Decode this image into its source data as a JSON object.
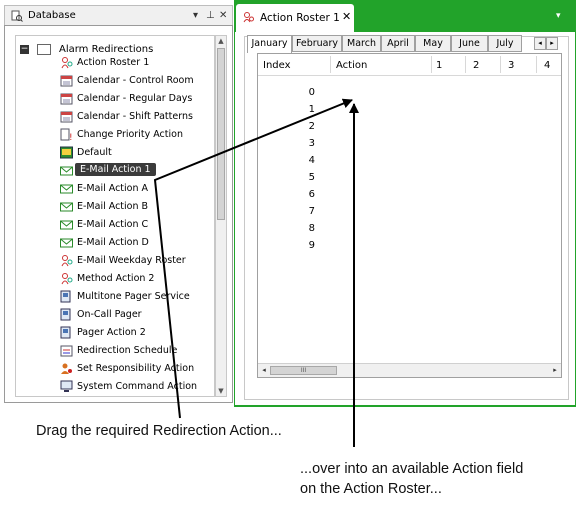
{
  "database_pane": {
    "title": "Database",
    "dropdown_icon": "▾",
    "pin_icon": "⊥",
    "close_icon": "✕",
    "root": {
      "label": "Alarm Redirections",
      "expander": "−"
    },
    "items": [
      {
        "label": "Action Roster 1",
        "icon": "action-roster-icon"
      },
      {
        "label": "Calendar - Control Room",
        "icon": "calendar-icon"
      },
      {
        "label": "Calendar - Regular Days",
        "icon": "calendar-icon"
      },
      {
        "label": "Calendar - Shift Patterns",
        "icon": "calendar-icon"
      },
      {
        "label": "Change Priority Action",
        "icon": "change-priority-icon"
      },
      {
        "label": "Default",
        "icon": "default-icon"
      },
      {
        "label": "E-Mail Action 1",
        "icon": "email-icon",
        "selected": true
      },
      {
        "label": "E-Mail Action A",
        "icon": "email-icon"
      },
      {
        "label": "E-Mail Action B",
        "icon": "email-icon"
      },
      {
        "label": "E-Mail Action C",
        "icon": "email-icon"
      },
      {
        "label": "E-Mail Action D",
        "icon": "email-icon"
      },
      {
        "label": "E-Mail Weekday Roster",
        "icon": "action-roster-icon"
      },
      {
        "label": "Method Action 2",
        "icon": "action-roster-icon"
      },
      {
        "label": "Multitone Pager Service",
        "icon": "pager-icon"
      },
      {
        "label": "On-Call Pager",
        "icon": "pager-icon"
      },
      {
        "label": "Pager Action 2",
        "icon": "pager-icon"
      },
      {
        "label": "Redirection Schedule",
        "icon": "schedule-icon"
      },
      {
        "label": "Set Responsibility Action",
        "icon": "responsibility-icon"
      },
      {
        "label": "System Command Action",
        "icon": "system-command-icon"
      }
    ]
  },
  "roster_pane": {
    "tab_title": "Action Roster 1",
    "close_icon": "✕",
    "dropdown_icon": "▾",
    "months": [
      "January",
      "February",
      "March",
      "April",
      "May",
      "June",
      "July"
    ],
    "active_month": "January",
    "tab_scroll_left": "◂",
    "tab_scroll_right": "▸",
    "columns": [
      "Index",
      "Action",
      "1",
      "2",
      "3",
      "4"
    ],
    "rows": [
      "0",
      "1",
      "2",
      "3",
      "4",
      "5",
      "6",
      "7",
      "8",
      "9"
    ],
    "hscroll_left": "◂",
    "hscroll_right": "▸",
    "hscroll_grip": "III"
  },
  "captions": {
    "drag": "Drag the required Redirection Action...",
    "drop_line1": "...over into an available Action field",
    "drop_line2": "on the Action Roster..."
  },
  "colors": {
    "accent_green": "#22a32a",
    "selection": "#3b3b3b"
  }
}
